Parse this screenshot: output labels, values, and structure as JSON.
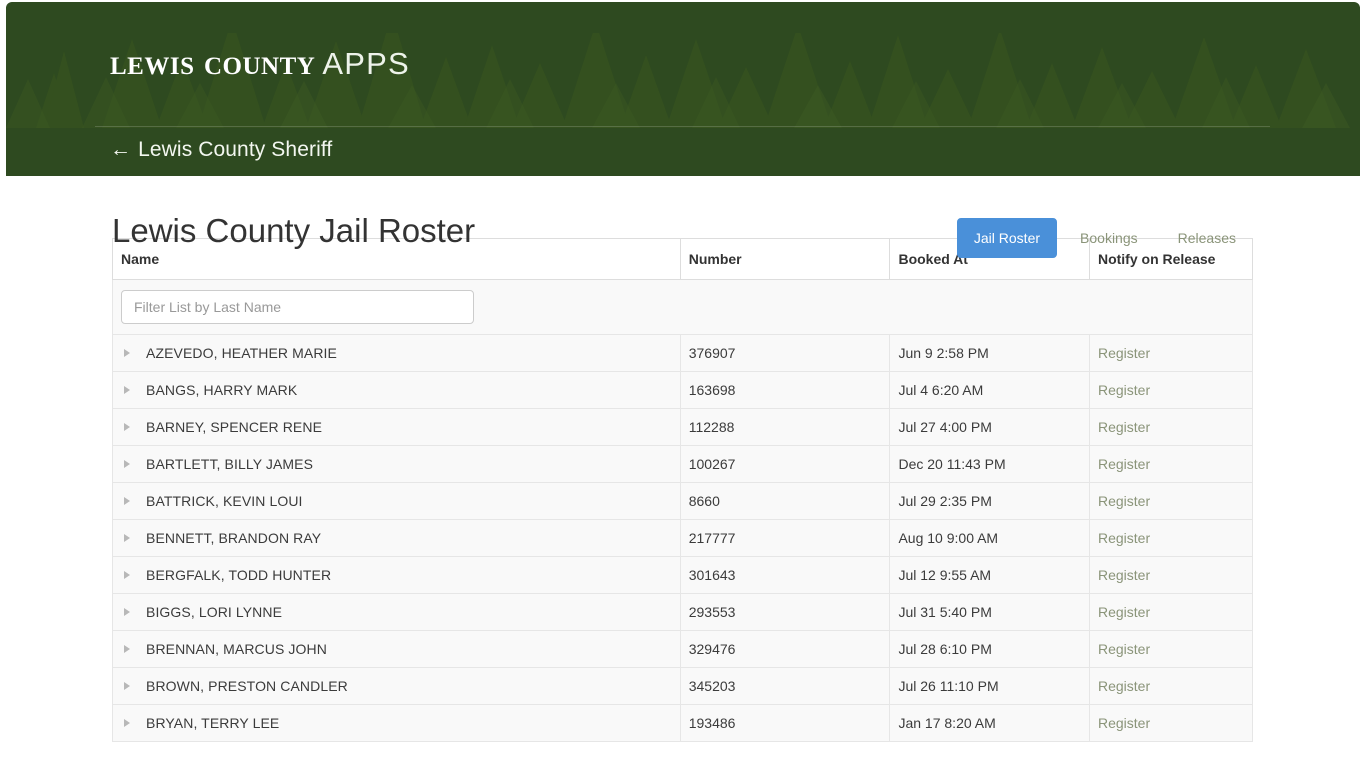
{
  "header": {
    "brand_primary": "Lewis County",
    "brand_secondary": "APPS",
    "back_arrow": "←",
    "back_label": "Lewis County Sheriff",
    "background_color": "#2e4a20"
  },
  "page": {
    "title": "Lewis County Jail Roster"
  },
  "tabs": [
    {
      "label": "Jail Roster",
      "active": true,
      "color": "#4a90d9"
    },
    {
      "label": "Bookings",
      "active": false,
      "color": "#8a9479"
    },
    {
      "label": "Releases",
      "active": false,
      "color": "#8a9479"
    }
  ],
  "filter": {
    "placeholder": "Filter List by Last Name",
    "value": ""
  },
  "table": {
    "columns": [
      "Name",
      "Number",
      "Booked At",
      "Notify on Release"
    ],
    "register_label": "Register",
    "rows": [
      {
        "name": "AZEVEDO, HEATHER MARIE",
        "number": "376907",
        "booked_at": "Jun 9 2:58 PM",
        "notify": "Register"
      },
      {
        "name": "BANGS, HARRY MARK",
        "number": "163698",
        "booked_at": "Jul 4 6:20 AM",
        "notify": "Register"
      },
      {
        "name": "BARNEY, SPENCER RENE",
        "number": "112288",
        "booked_at": "Jul 27 4:00 PM",
        "notify": "Register"
      },
      {
        "name": "BARTLETT, BILLY JAMES",
        "number": "100267",
        "booked_at": "Dec 20 11:43 PM",
        "notify": "Register"
      },
      {
        "name": "BATTRICK, KEVIN LOUI",
        "number": "8660",
        "booked_at": "Jul 29 2:35 PM",
        "notify": "Register"
      },
      {
        "name": "BENNETT, BRANDON RAY",
        "number": "217777",
        "booked_at": "Aug 10 9:00 AM",
        "notify": "Register"
      },
      {
        "name": "BERGFALK, TODD HUNTER",
        "number": "301643",
        "booked_at": "Jul 12 9:55 AM",
        "notify": "Register"
      },
      {
        "name": "BIGGS, LORI LYNNE",
        "number": "293553",
        "booked_at": "Jul 31 5:40 PM",
        "notify": "Register"
      },
      {
        "name": "BRENNAN, MARCUS JOHN",
        "number": "329476",
        "booked_at": "Jul 28 6:10 PM",
        "notify": "Register"
      },
      {
        "name": "BROWN, PRESTON CANDLER",
        "number": "345203",
        "booked_at": "Jul 26 11:10 PM",
        "notify": "Register"
      },
      {
        "name": "BRYAN, TERRY LEE",
        "number": "193486",
        "booked_at": "Jan 17 8:20 AM",
        "notify": "Register"
      }
    ]
  }
}
